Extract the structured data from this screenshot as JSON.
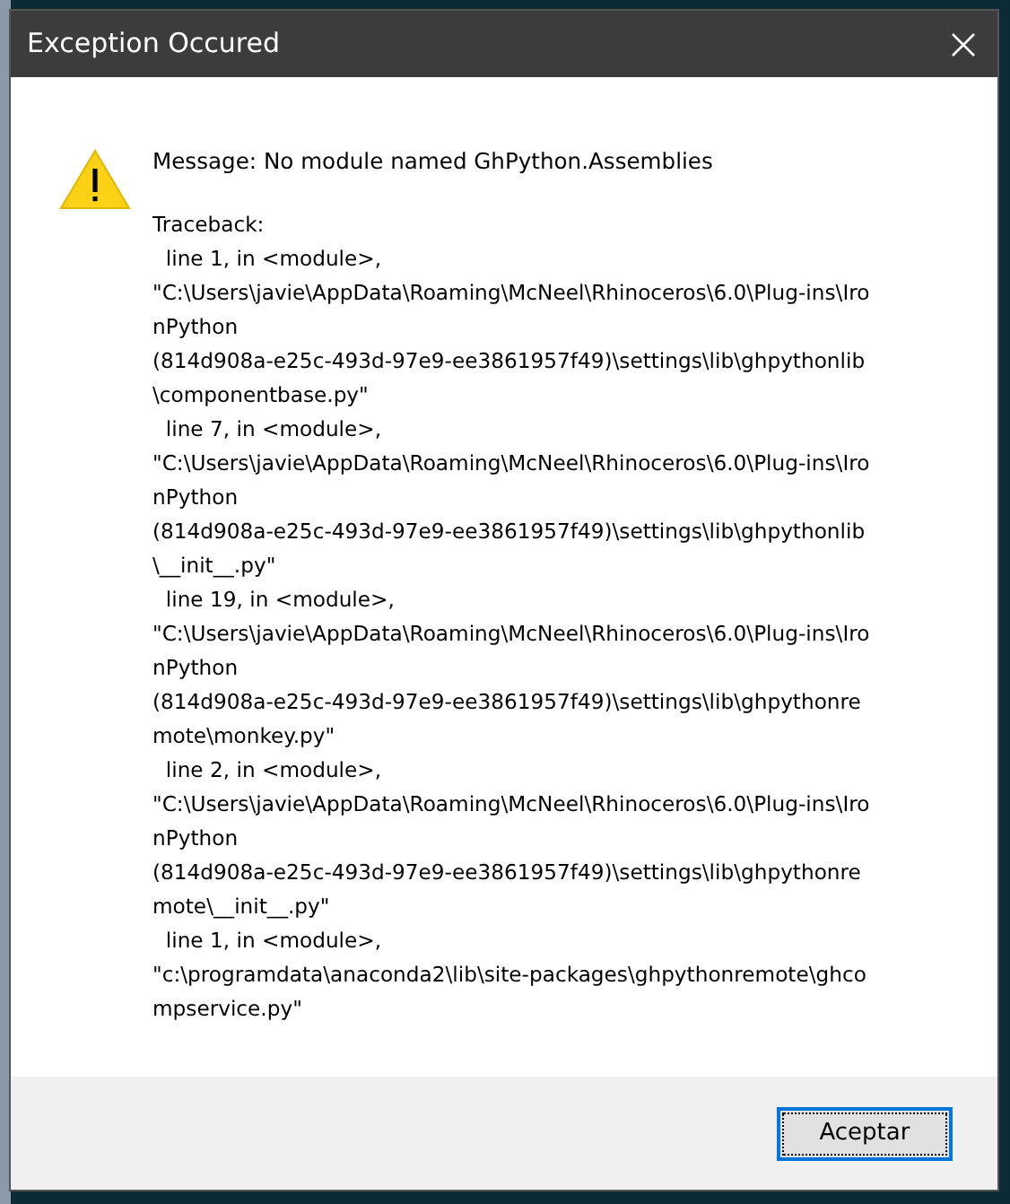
{
  "window": {
    "title": "Exception Occured"
  },
  "message": "Message: No module named GhPython.Assemblies",
  "traceback_lines": [
    "Traceback:",
    "  line 1, in <module>,",
    "\"C:\\Users\\javie\\AppData\\Roaming\\McNeel\\Rhinoceros\\6.0\\Plug-ins\\Iro",
    "nPython",
    "(814d908a-e25c-493d-97e9-ee3861957f49)\\settings\\lib\\ghpythonlib",
    "\\componentbase.py\"",
    "  line 7, in <module>,",
    "\"C:\\Users\\javie\\AppData\\Roaming\\McNeel\\Rhinoceros\\6.0\\Plug-ins\\Iro",
    "nPython",
    "(814d908a-e25c-493d-97e9-ee3861957f49)\\settings\\lib\\ghpythonlib",
    "\\__init__.py\"",
    "  line 19, in <module>,",
    "\"C:\\Users\\javie\\AppData\\Roaming\\McNeel\\Rhinoceros\\6.0\\Plug-ins\\Iro",
    "nPython",
    "(814d908a-e25c-493d-97e9-ee3861957f49)\\settings\\lib\\ghpythonre",
    "mote\\monkey.py\"",
    "  line 2, in <module>,",
    "\"C:\\Users\\javie\\AppData\\Roaming\\McNeel\\Rhinoceros\\6.0\\Plug-ins\\Iro",
    "nPython",
    "(814d908a-e25c-493d-97e9-ee3861957f49)\\settings\\lib\\ghpythonre",
    "mote\\__init__.py\"",
    "  line 1, in <module>,",
    "\"c:\\programdata\\anaconda2\\lib\\site-packages\\ghpythonremote\\ghco",
    "mpservice.py\""
  ],
  "buttons": [
    {
      "label": "Aceptar",
      "selected": true
    }
  ]
}
